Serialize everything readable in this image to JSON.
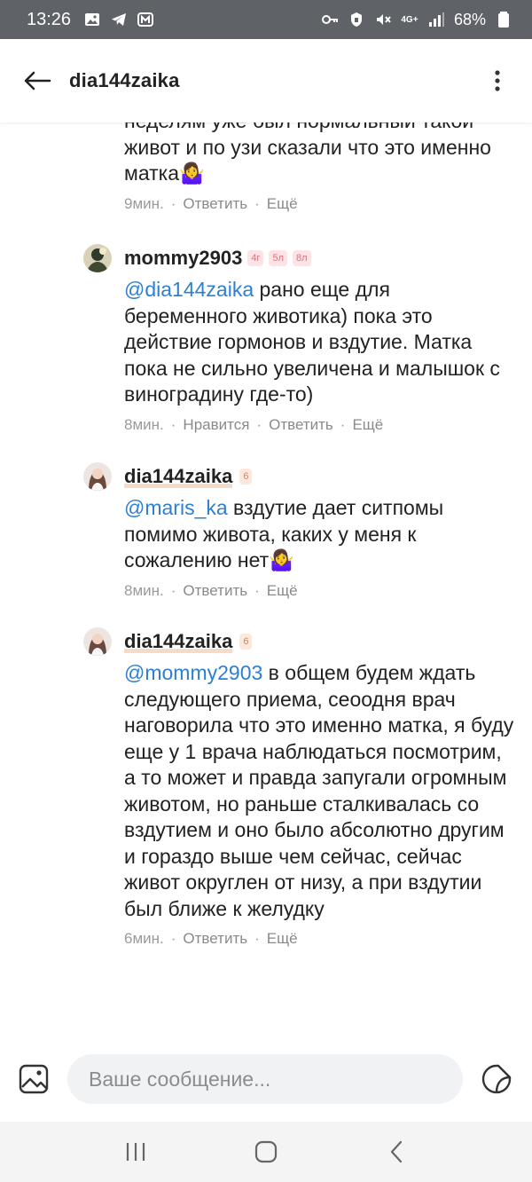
{
  "status_bar": {
    "time": "13:26",
    "left_icons": [
      "gallery-icon",
      "telegram-icon",
      "app-m-icon"
    ],
    "right_icons": [
      "key-icon",
      "vpn-icon",
      "mute-icon",
      "signal-4g-icon",
      "signal-bars-icon",
      "battery-icon"
    ],
    "network_label": "4G+",
    "battery": "68%"
  },
  "header": {
    "title": "dia144zaika"
  },
  "comments": [
    {
      "text": "неделям уже был нормальный такой живот и по узи сказали что это именно матка🤷‍♀️",
      "time": "9мин.",
      "actions": [
        "Ответить",
        "Ещё"
      ]
    },
    {
      "author": "mommy2903",
      "badges": [
        "4г",
        "5л",
        "8л"
      ],
      "mention": "@dia144zaika",
      "text": " рано еще для беременного животика) пока это действие гормонов и вздутие. Матка пока не сильно увеличена и малышок с виноградину где-то)",
      "time": "8мин.",
      "actions": [
        "Нравится",
        "Ответить",
        "Ещё"
      ]
    },
    {
      "author": "dia144zaika",
      "badges": [
        "6"
      ],
      "mention": "@maris_ka",
      "text": " вздутие дает ситпомы помимо живота, каких у меня к сожалению нет🤷‍♀️",
      "time": "8мин.",
      "actions": [
        "Ответить",
        "Ещё"
      ]
    },
    {
      "author": "dia144zaika",
      "badges": [
        "6"
      ],
      "mention": "@mommy2903",
      "text": " в общем будем ждать следующего приема, сеоодня врач наговорила что это именно матка, я буду еще у 1 врача наблюдаться посмотрим, а то может и правда запугали огромным животом, но раньше сталкивалась со вздутием и оно было абсолютно другим и гораздо выше чем сейчас, сейчас живот округлен от низу, а при вздутии был ближе к желудку",
      "time": "6мин.",
      "actions": [
        "Ответить",
        "Ещё"
      ]
    }
  ],
  "input": {
    "placeholder": "Ваше сообщение..."
  },
  "colors": {
    "mention": "#2d7fd3",
    "status_bar": "#5f6368",
    "badge_pink": "#fde3e6",
    "badge_orange": "#fde8dc"
  }
}
